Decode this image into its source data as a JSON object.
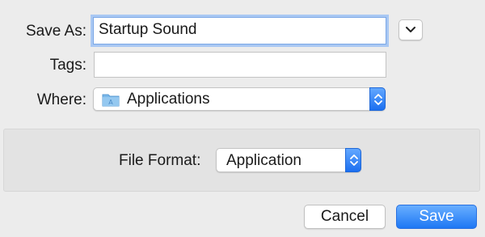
{
  "save_as": {
    "label": "Save As:",
    "value": "Startup Sound"
  },
  "tags": {
    "label": "Tags:",
    "value": ""
  },
  "where": {
    "label": "Where:",
    "value": "Applications",
    "icon": "folder-icon"
  },
  "file_format": {
    "label": "File Format:",
    "value": "Application"
  },
  "buttons": {
    "cancel": "Cancel",
    "save": "Save"
  },
  "colors": {
    "accent": "#1e78f4",
    "focus_ring": "#a9c8f3",
    "folder": "#7ab8ea"
  }
}
